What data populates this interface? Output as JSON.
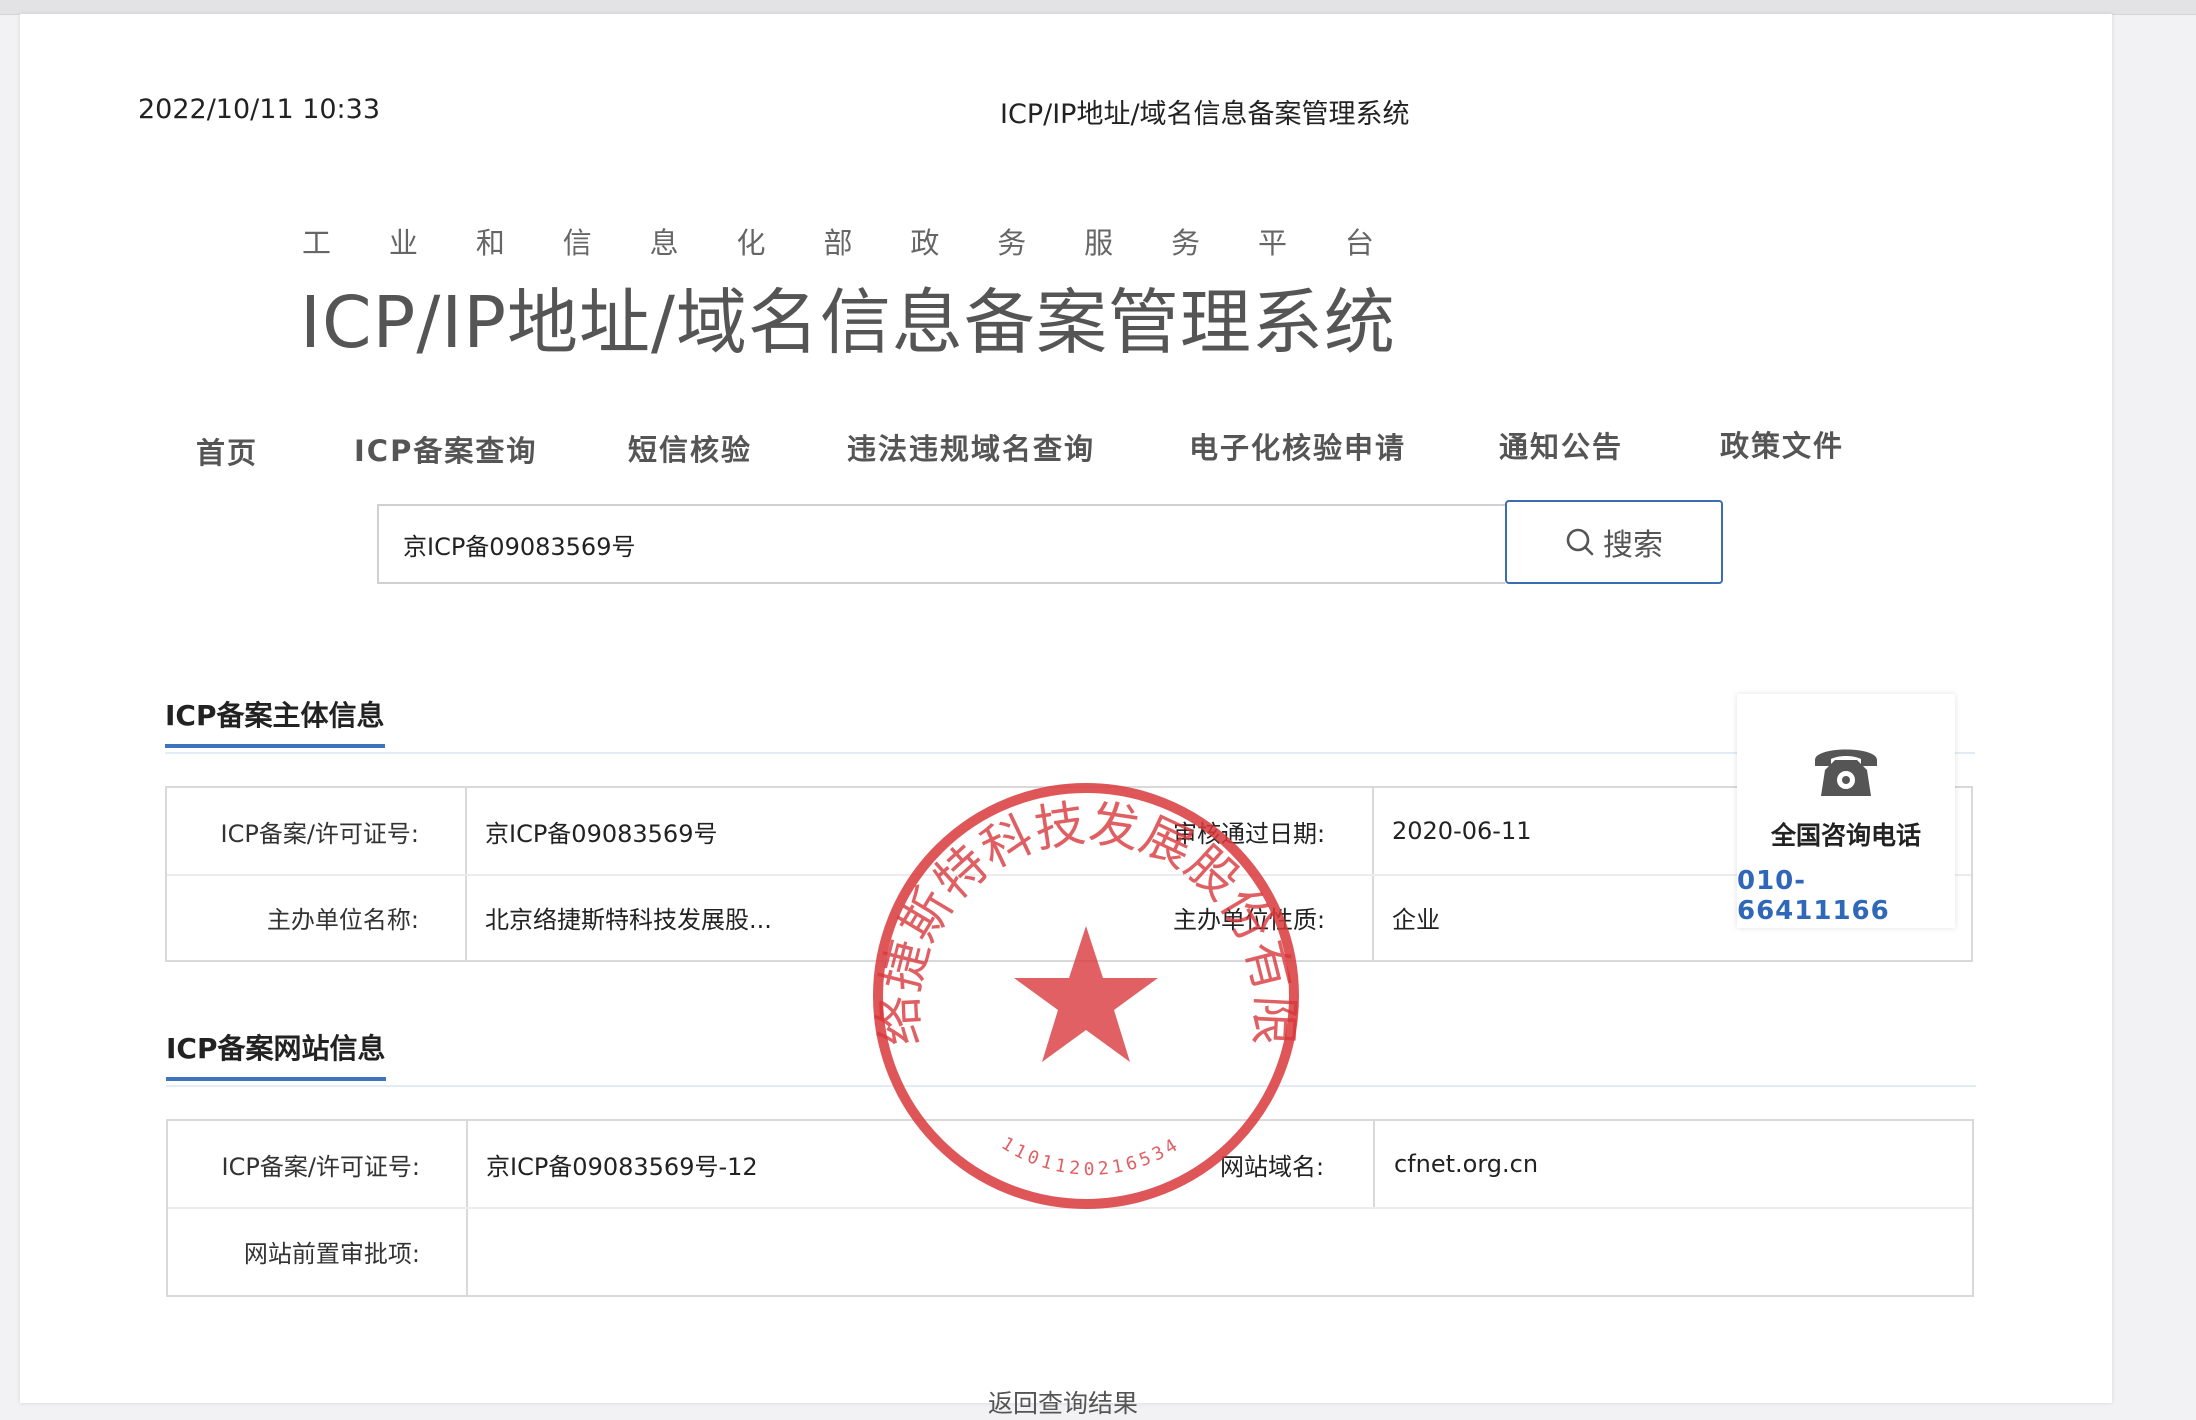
{
  "print_header": {
    "datetime": "2022/10/11 10:33",
    "title": "ICP/IP地址/域名信息备案管理系统"
  },
  "brand": {
    "ministry_chars": [
      "工",
      "业",
      "和",
      "信",
      "息",
      "化",
      "部",
      "政",
      "务",
      "服",
      "务",
      "平",
      "台"
    ],
    "system_title": "ICP/IP地址/域名信息备案管理系统"
  },
  "nav": {
    "items": [
      "首页",
      "ICP备案查询",
      "短信核验",
      "违法违规域名查询",
      "电子化核验申请",
      "通知公告",
      "政策文件"
    ]
  },
  "search": {
    "value": "京ICP备09083569号",
    "button_label": "搜索",
    "icon": "search-icon"
  },
  "entity_section": {
    "title": "ICP备案主体信息",
    "license_label": "ICP备案/许可证号:",
    "license_value": "京ICP备09083569号",
    "approval_date_label": "审核通过日期:",
    "approval_date_value": "2020-06-11",
    "org_name_label": "主办单位名称:",
    "org_name_value": "北京络捷斯特科技发展股...",
    "org_type_label": "主办单位性质:",
    "org_type_value": "企业"
  },
  "website_section": {
    "title": "ICP备案网站信息",
    "license_label": "ICP备案/许可证号:",
    "license_value": "京ICP备09083569号-12",
    "domain_label": "网站域名:",
    "domain_value": "cfnet.org.cn",
    "pre_approval_label": "网站前置审批项:",
    "pre_approval_value": ""
  },
  "hotline": {
    "icon": "telephone-icon",
    "label": "全国咨询电话",
    "number": "010-66411166"
  },
  "back_link": "返回查询结果",
  "stamp": {
    "text": "北京络捷斯特科技发展股份有限公司",
    "code": "1101120216534",
    "color": "#d9383c"
  },
  "colors": {
    "accent": "#3e74be",
    "link": "#2f68b8",
    "stamp": "#d9383c"
  }
}
